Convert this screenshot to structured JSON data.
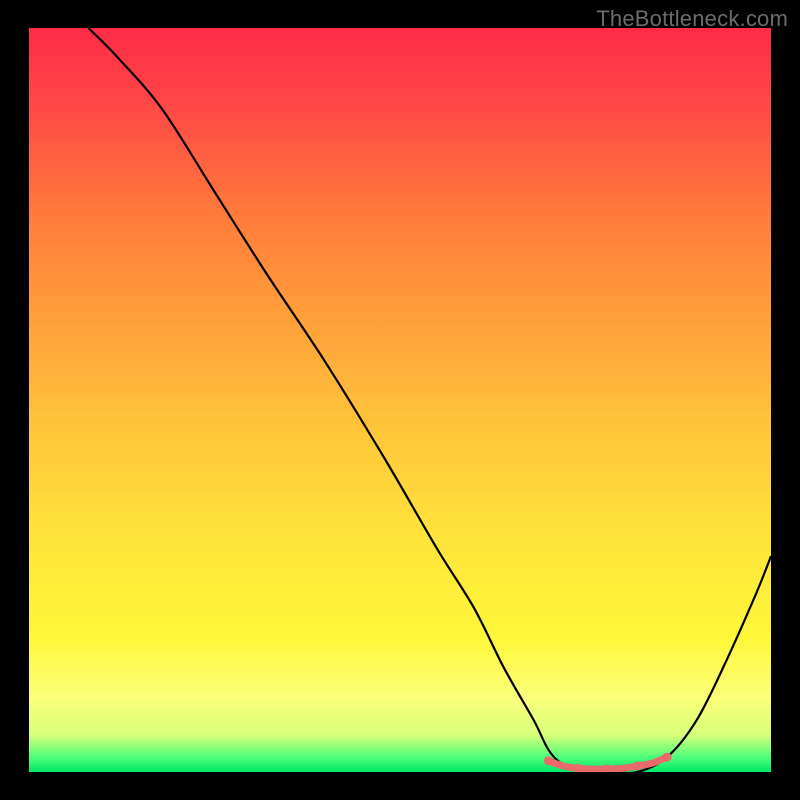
{
  "watermark": "TheBottleneck.com",
  "chart_data": {
    "type": "line",
    "title": "",
    "xlabel": "",
    "ylabel": "",
    "xlim": [
      0,
      100
    ],
    "ylim": [
      0,
      100
    ],
    "grid": false,
    "legend": false,
    "series": [
      {
        "name": "bottleneck-curve",
        "color": "#000000",
        "x": [
          8,
          12,
          18,
          25,
          32,
          40,
          48,
          55,
          60,
          64,
          68,
          70,
          72,
          75,
          78,
          82,
          86,
          90,
          94,
          98,
          100
        ],
        "y": [
          100,
          96,
          89,
          78,
          67,
          55,
          42,
          30,
          22,
          14,
          7,
          3,
          1,
          0,
          0,
          0,
          2,
          7,
          15,
          24,
          29
        ]
      },
      {
        "name": "optimal-range-marker",
        "color": "#e86a6a",
        "x": [
          70,
          72,
          74,
          76,
          78,
          80,
          82,
          84,
          86
        ],
        "y": [
          1.5,
          0.8,
          0.5,
          0.4,
          0.4,
          0.5,
          0.8,
          1.2,
          2
        ]
      }
    ],
    "background_gradient": {
      "top": "#ff2b47",
      "bottom": "#00e868"
    }
  }
}
